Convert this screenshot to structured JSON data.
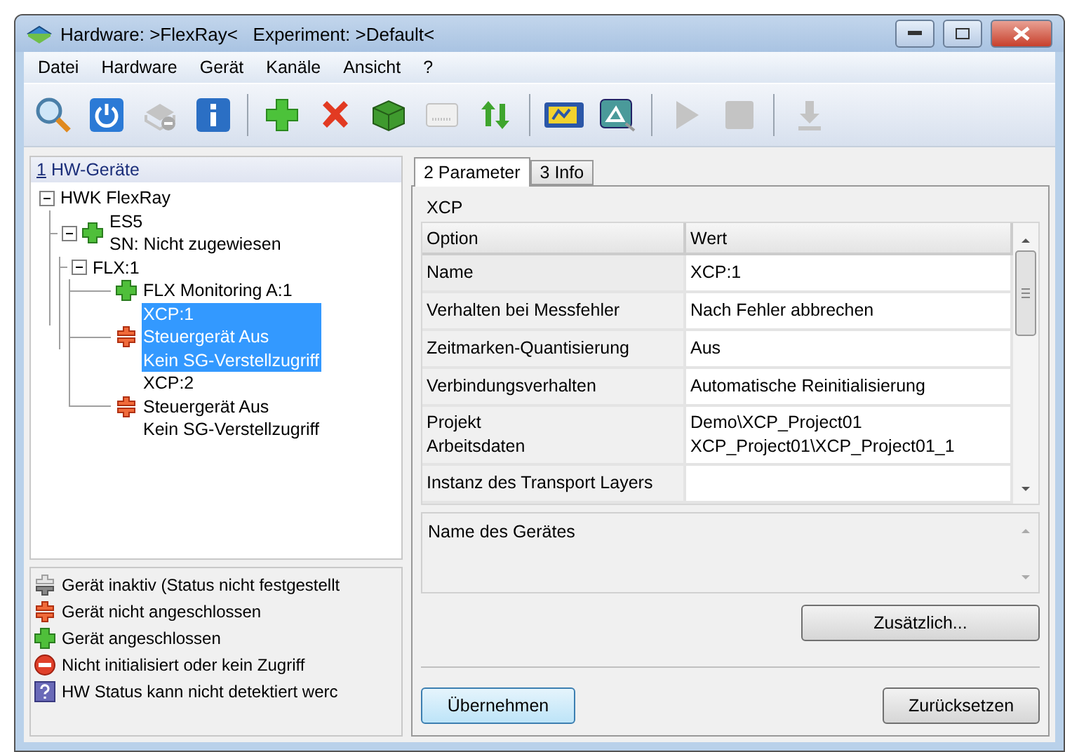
{
  "window": {
    "title": "Hardware: >FlexRay<   Experiment: >Default<"
  },
  "menu": [
    "Datei",
    "Hardware",
    "Gerät",
    "Kanäle",
    "Ansicht",
    "?"
  ],
  "toolbar": [
    [
      {
        "kind": "search",
        "disabled": false
      },
      {
        "kind": "power",
        "disabled": false
      },
      {
        "kind": "device",
        "disabled": true
      },
      {
        "kind": "info",
        "disabled": false
      }
    ],
    [
      {
        "kind": "add",
        "disabled": false
      },
      {
        "kind": "remove",
        "disabled": false
      },
      {
        "kind": "module",
        "disabled": false
      },
      {
        "kind": "id",
        "disabled": true
      },
      {
        "kind": "updown",
        "disabled": false
      }
    ],
    [
      {
        "kind": "card",
        "disabled": false
      },
      {
        "kind": "monitor",
        "disabled": false
      }
    ],
    [
      {
        "kind": "play",
        "disabled": true
      },
      {
        "kind": "stop",
        "disabled": true
      }
    ],
    [
      {
        "kind": "download",
        "disabled": true
      }
    ]
  ],
  "left_panel": {
    "hotkey": "1",
    "title": "HW-Geräte"
  },
  "tree": [
    {
      "lines": [
        "HWK FlexRay"
      ],
      "expanded": true,
      "selected": false,
      "children": [
        {
          "kind": "connected",
          "lines": [
            "ES5",
            "SN: Nicht zugewiesen"
          ],
          "expanded": true,
          "selected": false,
          "children": [
            {
              "lines": [
                "FLX:1"
              ],
              "expanded": true,
              "selected": false,
              "children": [
                {
                  "kind": "connected",
                  "lines": [
                    "FLX Monitoring A:1"
                  ],
                  "selected": false
                },
                {
                  "kind": "disconnected",
                  "lines": [
                    "XCP:1",
                    "Steuergerät Aus",
                    "Kein SG-Verstellzugriff"
                  ],
                  "selected": true
                },
                {
                  "kind": "disconnected",
                  "lines": [
                    "XCP:2",
                    "Steuergerät Aus",
                    "Kein SG-Verstellzugriff"
                  ],
                  "selected": false
                }
              ]
            }
          ]
        }
      ]
    }
  ],
  "legend": [
    {
      "kind": "inactive",
      "text": "Gerät inaktiv (Status nicht festgestellt"
    },
    {
      "kind": "disconnected",
      "text": "Gerät nicht angeschlossen"
    },
    {
      "kind": "connected",
      "text": "Gerät angeschlossen"
    },
    {
      "kind": "error",
      "text": "Nicht initialisiert oder kein Zugriff"
    },
    {
      "kind": "unknown",
      "text": "HW Status kann nicht detektiert werc"
    }
  ],
  "tabs": [
    {
      "label": "2 Parameter",
      "selected": true
    },
    {
      "label": "3 Info",
      "selected": false
    }
  ],
  "group_title": "XCP",
  "table": {
    "columns": [
      "Option",
      "Wert"
    ],
    "rows": [
      {
        "option": [
          "Name"
        ],
        "value": [
          "XCP:1"
        ]
      },
      {
        "option": [
          "Verhalten bei Messfehler"
        ],
        "value": [
          "Nach Fehler abbrechen"
        ]
      },
      {
        "option": [
          "Zeitmarken-Quantisierung"
        ],
        "value": [
          "Aus"
        ]
      },
      {
        "option": [
          "Verbindungsverhalten"
        ],
        "value": [
          "Automatische Reinitialisierung"
        ]
      },
      {
        "option": [
          "Projekt",
          "Arbeitsdaten"
        ],
        "value": [
          "Demo\\XCP_Project01",
          "XCP_Project01\\XCP_Project01_1"
        ]
      },
      {
        "option": [
          "Instanz des Transport Layers"
        ],
        "value": []
      }
    ]
  },
  "description": "Name des Gerätes",
  "buttons": {
    "extra": "Zusätzlich...",
    "apply": "Übernehmen",
    "reset": "Zurücksetzen"
  }
}
